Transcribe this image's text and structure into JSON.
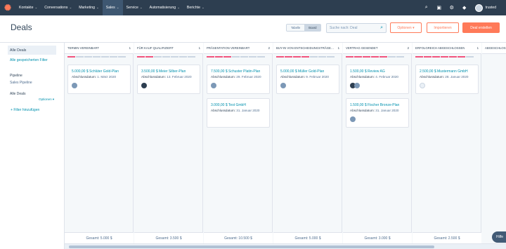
{
  "nav": {
    "items": [
      "Kontakte",
      "Conversations",
      "Marketing",
      "Sales",
      "Service",
      "Automatisierung",
      "Berichte"
    ],
    "user": "trusted"
  },
  "header": {
    "title": "Deals",
    "view_table": "Tabelle",
    "view_board": "Board",
    "search_placeholder": "Suche nach: Deal",
    "options": "Optionen",
    "import": "Importieren",
    "create": "Deal erstellen"
  },
  "sidebar": {
    "all_deals": "Alle Deals",
    "saved_filters": "Alle gespeicherten Filter",
    "pipeline_label": "Pipeline",
    "pipeline_value": "Sales Pipeline",
    "all_deals_2": "Alle Deals",
    "options": "Optionen",
    "add_filter": "Filter hinzufügen"
  },
  "columns": [
    {
      "name": "TERMIN VEREINBART",
      "count": "1",
      "progress": 1,
      "total": "Gesamt: 5.000 $",
      "cards": [
        {
          "title": "5.000,00 $ Schlüter Gold-Plan",
          "label": "Abschlussdatum:",
          "date": "1. März 2020",
          "avatar": "gray"
        }
      ]
    },
    {
      "name": "FÜR KAUF QUALIFIZIERT",
      "count": "1",
      "progress": 2,
      "total": "Gesamt: 3.500 $",
      "cards": [
        {
          "title": "3.500,00 $ Meier Silber-Plan",
          "label": "Abschlussdatum:",
          "date": "13. Februar 2020",
          "avatar": "dark"
        }
      ]
    },
    {
      "name": "PRÄSENTATION VEREINBART",
      "count": "2",
      "progress": 3,
      "total": "Gesamt: 10.500 $",
      "cards": [
        {
          "title": "7.500,00 $ Schuster Platin-Plan",
          "label": "Abschlussdatum:",
          "date": "29. Februar 2020",
          "avatar": "gray"
        },
        {
          "title": "3.000,00 $ Test GmbH",
          "label": "Abschlussdatum:",
          "date": "31. Januar 2020",
          "avatar": "none"
        }
      ]
    },
    {
      "name": "BUY-IN VON ENTSCHEIDUNGSTRÄGER ERHALTEN",
      "count": "1",
      "progress": 4,
      "total": "Gesamt: 5.000 $",
      "cards": [
        {
          "title": "5.000,00 $ Müller Gold-Plan",
          "label": "Abschlussdatum:",
          "date": "9. Februar 2020",
          "avatar": "gray"
        }
      ]
    },
    {
      "name": "VERTRAG GESENDET",
      "count": "2",
      "progress": 5,
      "total": "Gesamt: 3.000 $",
      "cards": [
        {
          "title": "1.500,00 $ Review AG",
          "label": "Abschlussdatum:",
          "date": "4. Februar 2020",
          "avatar": "double"
        },
        {
          "title": "1.500,00 $ Fischer Bronze-Plan",
          "label": "Abschlussdatum:",
          "date": "31. Januar 2020",
          "avatar": "gray"
        }
      ]
    },
    {
      "name": "ERFOLGREICH ABGESCHLOSSEN",
      "count": "1",
      "progress": 6,
      "total": "Gesamt: 2.500 $",
      "cards": [
        {
          "title": "2.500,00 $ Mustermann GmbH",
          "label": "Abschlussdatum:",
          "date": "28. Januar 2020",
          "avatar": "light"
        }
      ]
    },
    {
      "name": "ABGESCHLOSSEN",
      "count": "",
      "progress": 0,
      "total": "",
      "cards": []
    }
  ],
  "help": "Hilfe"
}
